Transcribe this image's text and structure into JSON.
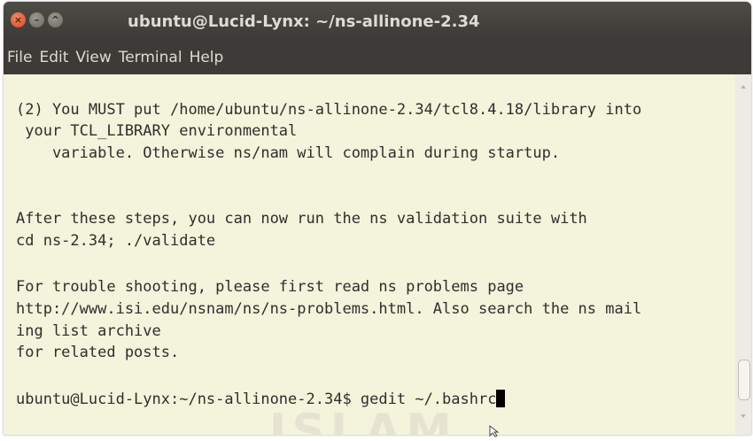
{
  "window": {
    "title": "ubuntu@Lucid-Lynx: ~/ns-allinone-2.34",
    "controls": {
      "close": "×",
      "minimize": "–",
      "maximize": "^"
    }
  },
  "menu": {
    "items": [
      "File",
      "Edit",
      "View",
      "Terminal",
      "Help"
    ]
  },
  "terminal": {
    "lines": [
      "(2) You MUST put /home/ubuntu/ns-allinone-2.34/tcl8.4.18/library into",
      " your TCL_LIBRARY environmental",
      "    variable. Otherwise ns/nam will complain during startup.",
      "",
      "",
      "After these steps, you can now run the ns validation suite with",
      "cd ns-2.34; ./validate",
      "",
      "For trouble shooting, please first read ns problems page",
      "http://www.isi.edu/nsnam/ns/ns-problems.html. Also search the ns mail",
      "ing list archive",
      "for related posts.",
      ""
    ],
    "prompt": "ubuntu@Lucid-Lynx:~/ns-allinone-2.34$ gedit ~/.bashrc"
  },
  "watermark": {
    "text": "ISLAM"
  },
  "colors": {
    "titlebar": "#3c3b37",
    "terminal_bg": "#f4f3db",
    "close_button": "#e0592e",
    "text": "#2e2e2e"
  }
}
